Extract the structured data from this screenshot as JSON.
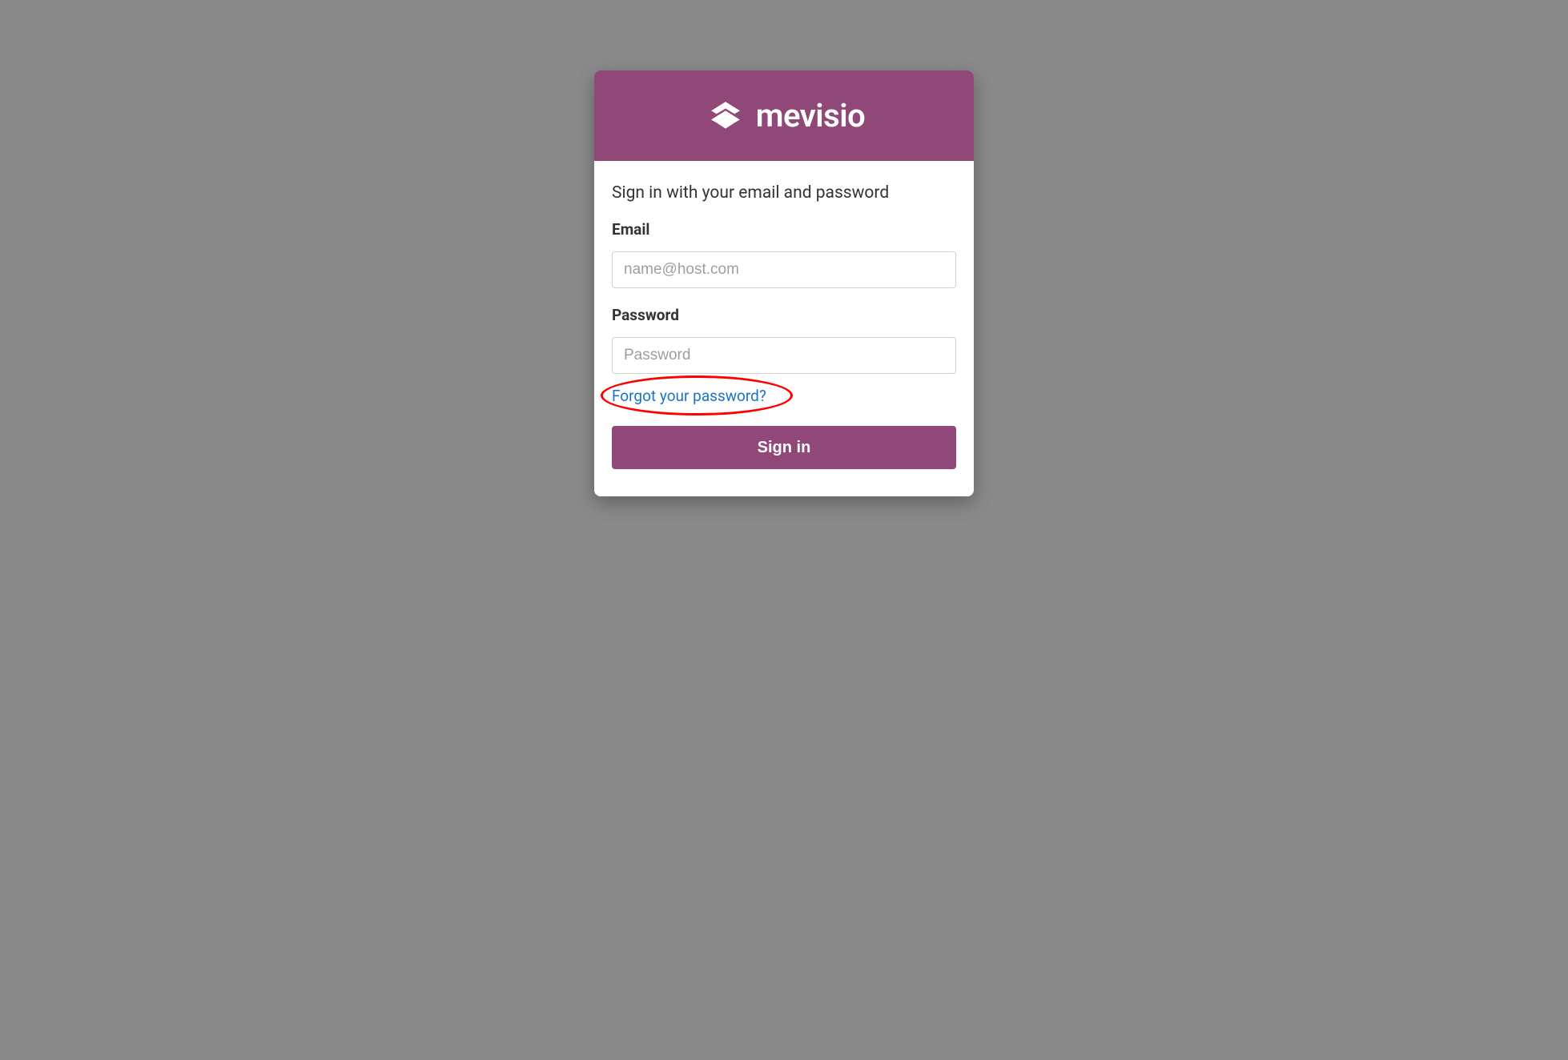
{
  "brand": {
    "name": "mevisio"
  },
  "form": {
    "heading": "Sign in with your email and password",
    "email_label": "Email",
    "email_placeholder": "name@host.com",
    "email_value": "",
    "password_label": "Password",
    "password_placeholder": "Password",
    "password_value": "",
    "forgot_link": "Forgot your password?",
    "submit_label": "Sign in"
  },
  "colors": {
    "brand": "#8f4877",
    "link": "#1a73c9",
    "annotation": "#ff0000"
  }
}
